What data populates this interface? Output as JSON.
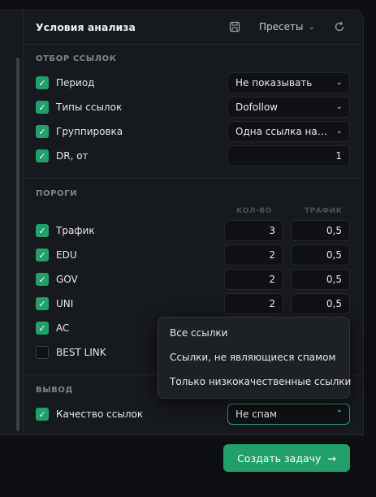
{
  "header": {
    "title": "Условия анализа",
    "presets_label": "Пресеты"
  },
  "link_selection": {
    "title": "ОТБОР ССЫЛОК",
    "rows": [
      {
        "label": "Период",
        "checked": true,
        "value": "Не показывать"
      },
      {
        "label": "Типы ссылок",
        "checked": true,
        "value": "Dofollow"
      },
      {
        "label": "Группировка",
        "checked": true,
        "value": "Одна ссылка на домен"
      },
      {
        "label": "DR, от",
        "checked": true,
        "value": "1"
      }
    ]
  },
  "thresholds": {
    "title": "ПОРОГИ",
    "col_count": "КОЛ-ВО",
    "col_traffic": "ТРАФИК",
    "rows": [
      {
        "label": "Трафик",
        "checked": true,
        "count": "3",
        "traffic": "0,5"
      },
      {
        "label": "EDU",
        "checked": true,
        "count": "2",
        "traffic": "0,5"
      },
      {
        "label": "GOV",
        "checked": true,
        "count": "2",
        "traffic": "0,5"
      },
      {
        "label": "UNI",
        "checked": true,
        "count": "2",
        "traffic": "0,5"
      },
      {
        "label": "AC",
        "checked": true
      },
      {
        "label": "BEST LINK",
        "checked": false
      }
    ]
  },
  "output": {
    "title": "ВЫВОД",
    "quality_label": "Качество ссылок",
    "quality_checked": true,
    "quality_value": "Не спам",
    "options": [
      "Все ссылки",
      "Ссылки, не являющиеся спамом",
      "Только низкокачественные ссылки"
    ]
  },
  "footer": {
    "create_label": "Создать задачу"
  },
  "colors": {
    "accent": "#22a06b",
    "panel": "#16191d",
    "background": "#0d0f12"
  },
  "icons": [
    "save-icon",
    "chevron-down-icon",
    "reset-icon",
    "check-icon",
    "arrow-right-icon",
    "chevron-up-icon"
  ]
}
